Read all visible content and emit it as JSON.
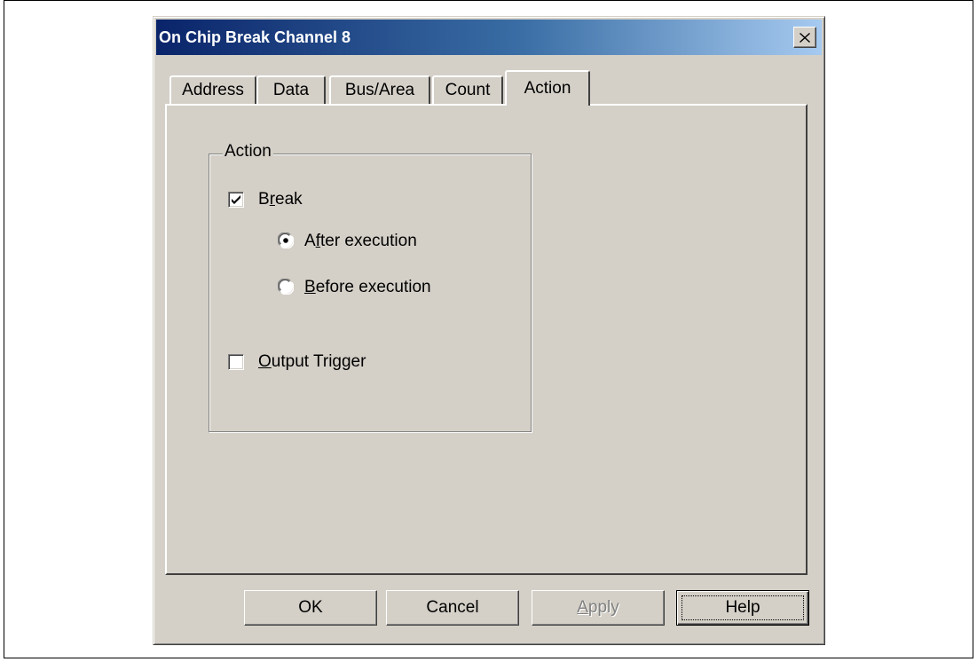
{
  "window": {
    "title": "On Chip Break Channel 8",
    "close_glyph": "✕"
  },
  "tabs": [
    {
      "label": "Address",
      "active": false
    },
    {
      "label": "Data",
      "active": false
    },
    {
      "label": "Bus/Area",
      "active": false
    },
    {
      "label": "Count",
      "active": false
    },
    {
      "label": "Action",
      "active": true
    }
  ],
  "action_group": {
    "title": "Action",
    "break": {
      "label": "Break",
      "checked": true
    },
    "after_execution": {
      "label": "After execution",
      "selected": true
    },
    "before_execution": {
      "label": "Before execution",
      "selected": false
    },
    "output_trigger": {
      "label": "Output Trigger",
      "checked": false
    }
  },
  "buttons": {
    "ok": "OK",
    "cancel": "Cancel",
    "apply": "Apply",
    "help": "Help"
  },
  "colors": {
    "dialog_face": "#d4d0c8",
    "title_start": "#0a246a",
    "title_end": "#a6caf0"
  }
}
